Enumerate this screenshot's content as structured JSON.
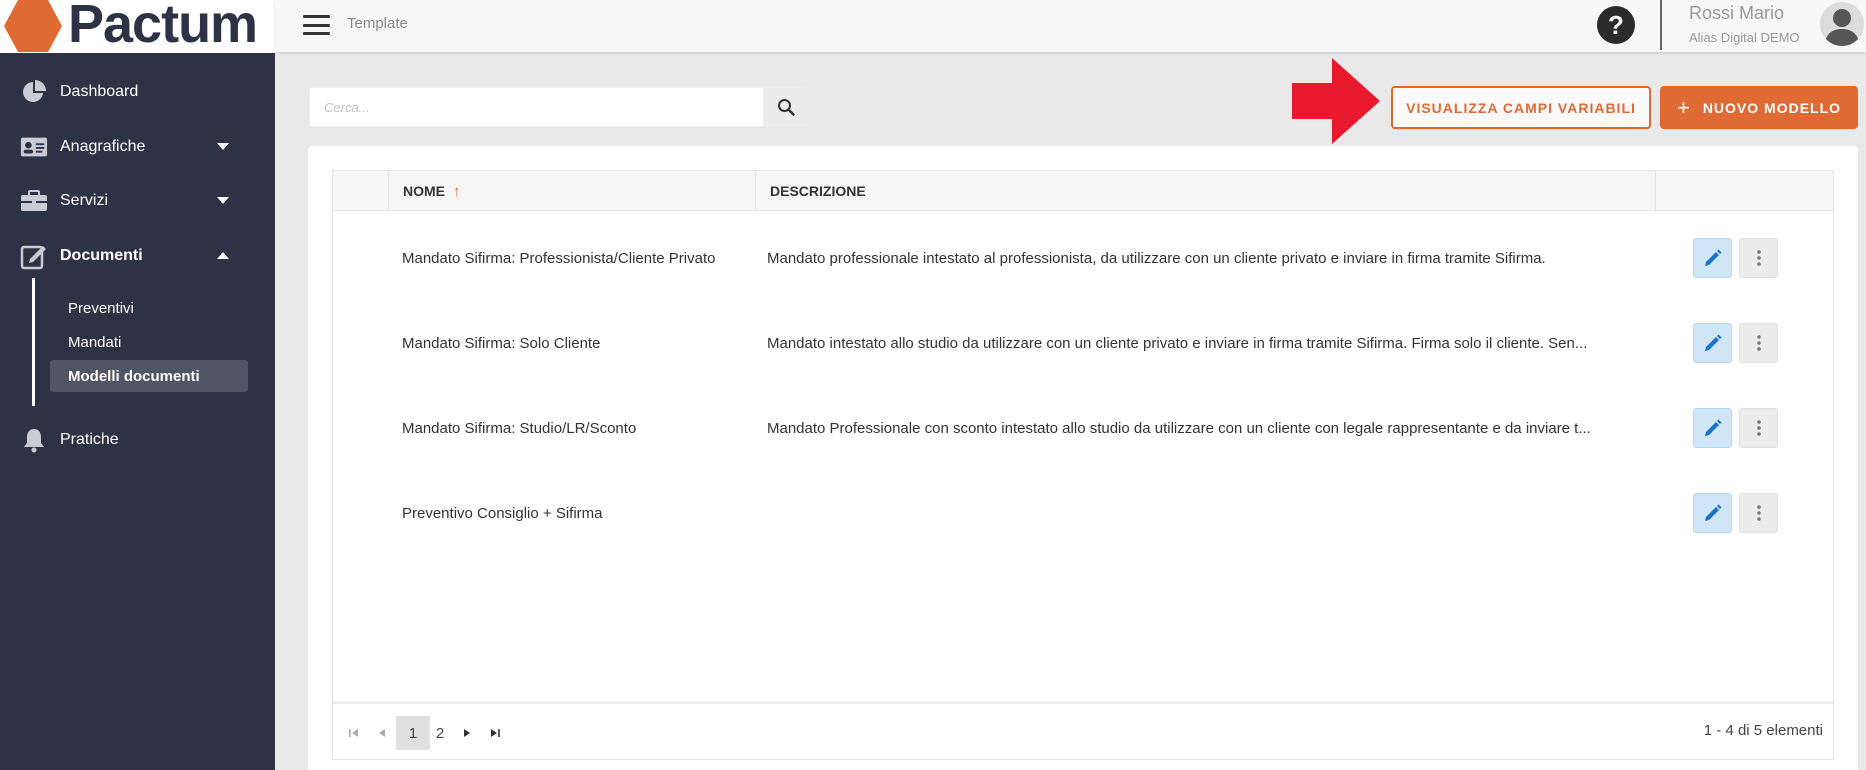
{
  "app": {
    "logo_text": "Pactum",
    "brand_color": "#e06a33",
    "sidebar_color": "#2d3345"
  },
  "topbar": {
    "breadcrumb": "Template",
    "help_label": "?",
    "user_name": "Rossi Mario",
    "user_org": "Alias Digital DEMO"
  },
  "sidebar": {
    "items": [
      {
        "label": "Dashboard",
        "icon": "pie-chart-icon"
      },
      {
        "label": "Anagrafiche",
        "icon": "id-card-icon"
      },
      {
        "label": "Servizi",
        "icon": "briefcase-icon"
      },
      {
        "label": "Documenti",
        "icon": "edit-document-icon"
      },
      {
        "label": "Pratiche",
        "icon": "bell-icon"
      }
    ],
    "subitems": [
      {
        "label": "Preventivi"
      },
      {
        "label": "Mandati"
      },
      {
        "label": "Modelli documenti"
      }
    ]
  },
  "toolbar": {
    "search_placeholder": "Cerca...",
    "show_vars_label": "VISUALIZZA CAMPI VARIABILI",
    "new_model_label": "NUOVO MODELLO",
    "plus": "+"
  },
  "table": {
    "columns": [
      {
        "label": "NOME"
      },
      {
        "label": "DESCRIZIONE"
      }
    ],
    "sort_indicator": "↑",
    "rows": [
      {
        "name": "Mandato Sifirma: Professionista/Cliente Privato",
        "description": "Mandato professionale intestato al professionista, da utilizzare con un cliente privato e inviare in firma tramite Sifirma."
      },
      {
        "name": "Mandato Sifirma: Solo Cliente",
        "description": "Mandato intestato allo studio da utilizzare con un cliente privato e inviare in firma tramite Sifirma. Firma solo il cliente. Sen..."
      },
      {
        "name": "Mandato Sifirma: Studio/LR/Sconto",
        "description": "Mandato Professionale con sconto intestato allo studio da utilizzare con un cliente con legale rappresentante e da inviare t..."
      },
      {
        "name": "Preventivo Consiglio + Sifirma",
        "description": ""
      }
    ]
  },
  "pager": {
    "pages": [
      {
        "label": "1"
      },
      {
        "label": "2"
      }
    ],
    "current_page": "1",
    "info": "1 - 4 di 5 elementi"
  }
}
